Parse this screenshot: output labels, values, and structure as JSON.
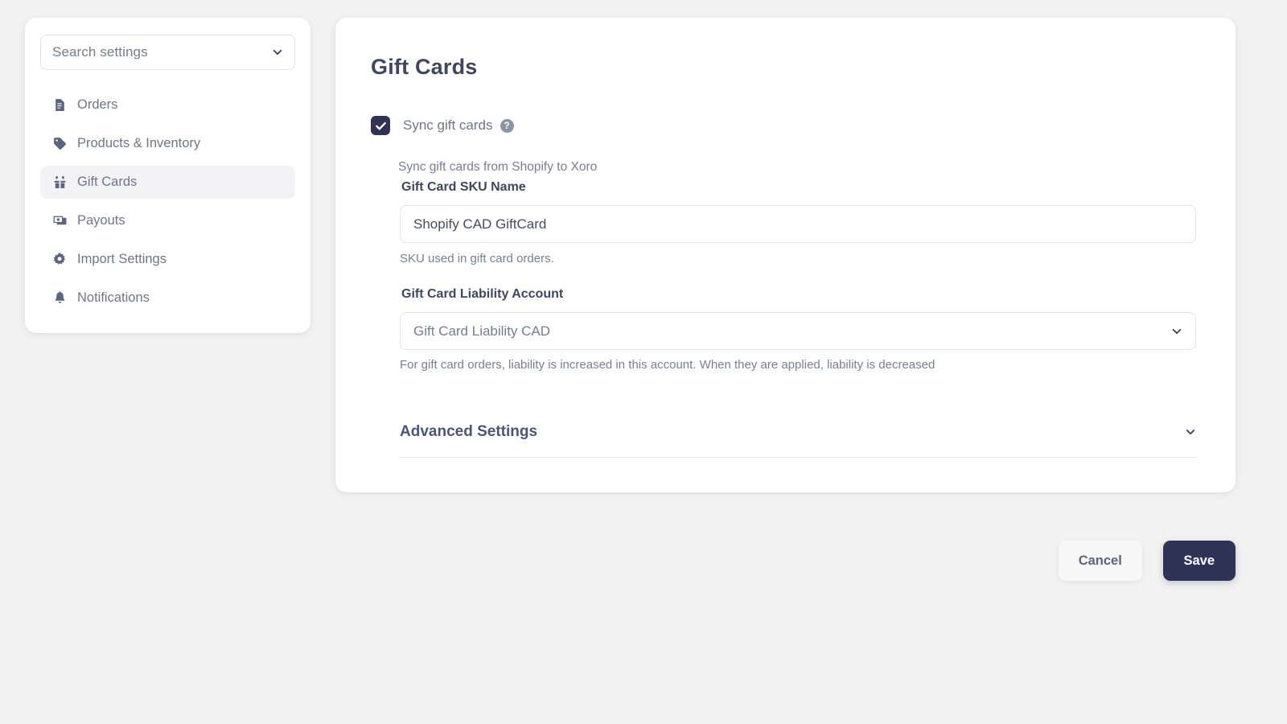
{
  "sidebar": {
    "search": {
      "placeholder": "Search settings",
      "chevron_icon": "chevron-down-icon"
    },
    "items": [
      {
        "label": "Orders",
        "icon": "document-icon",
        "active": false
      },
      {
        "label": "Products & Inventory",
        "icon": "tag-icon",
        "active": false
      },
      {
        "label": "Gift Cards",
        "icon": "gift-icon",
        "active": true
      },
      {
        "label": "Payouts",
        "icon": "money-bills-icon",
        "active": false
      },
      {
        "label": "Import Settings",
        "icon": "gear-icon",
        "active": false
      },
      {
        "label": "Notifications",
        "icon": "bell-icon",
        "active": false
      }
    ]
  },
  "main": {
    "title": "Gift Cards",
    "sync": {
      "label": "Sync gift cards",
      "checked": true,
      "help_icon": "question-mark-icon",
      "help_glyph": "?",
      "description": "Sync gift cards from Shopify to Xoro"
    },
    "sku_field": {
      "label": "Gift Card SKU Name",
      "value": "Shopify CAD GiftCard",
      "help": "SKU used in gift card orders."
    },
    "liability_field": {
      "label": "Gift Card Liability Account",
      "value": "Gift Card Liability CAD",
      "help": "For gift card orders, liability is increased in this account. When they are applied, liability is decreased",
      "chevron_icon": "chevron-down-icon"
    },
    "advanced": {
      "title": "Advanced Settings",
      "chevron_icon": "chevron-down-icon"
    }
  },
  "footer": {
    "cancel_label": "Cancel",
    "save_label": "Save"
  },
  "colors": {
    "page_background": "#f2f2f3",
    "card_background": "#ffffff",
    "accent_dark": "#2f3457",
    "heading": "#3e4760",
    "muted_text": "#767f96",
    "border": "#e3e4e9",
    "active_nav": "#f3f3f5"
  }
}
